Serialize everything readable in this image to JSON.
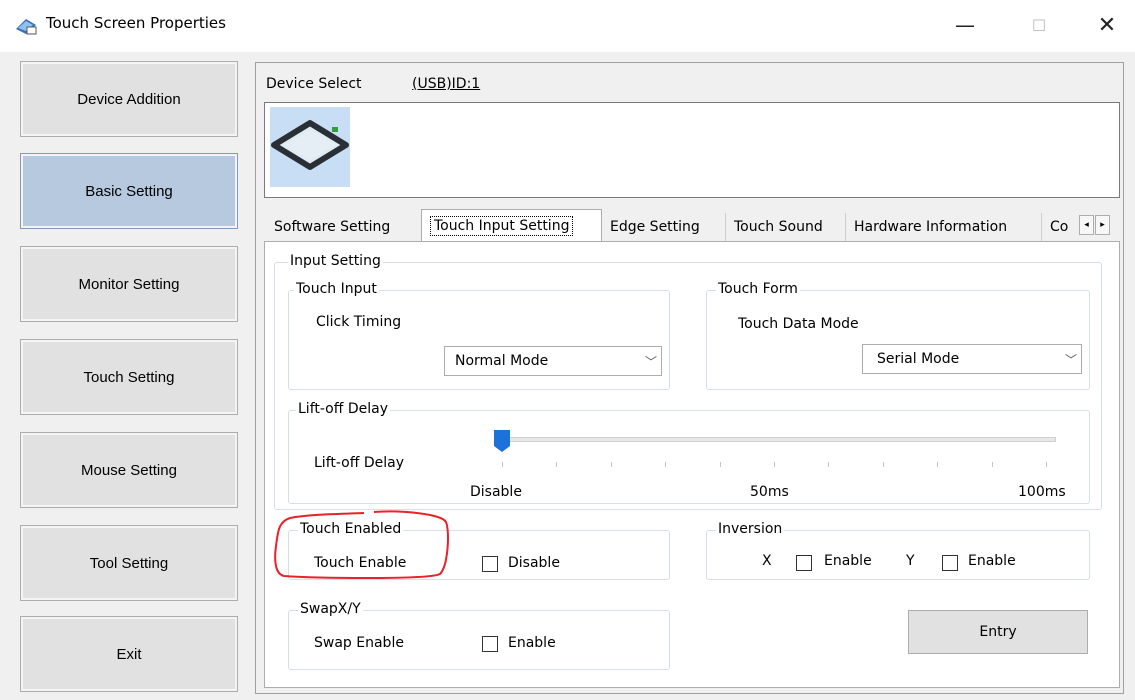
{
  "window": {
    "title": "Touch Screen Properties",
    "min_glyph": "—",
    "max_glyph": "☐",
    "close_glyph": "✕"
  },
  "sidebar": {
    "items": [
      {
        "label": "Device Addition",
        "active": false
      },
      {
        "label": "Basic Setting",
        "active": true
      },
      {
        "label": "Monitor Setting",
        "active": false
      },
      {
        "label": "Touch Setting",
        "active": false
      },
      {
        "label": "Mouse Setting",
        "active": false
      },
      {
        "label": "Tool Setting",
        "active": false
      },
      {
        "label": "Exit",
        "active": false
      }
    ]
  },
  "device_select": {
    "label": "Device Select",
    "value": "(USB)ID:1",
    "icon": "touchscreen-device-icon"
  },
  "tabs": [
    {
      "label": "Software Setting"
    },
    {
      "label": "Touch Input Setting",
      "active": true
    },
    {
      "label": "Edge Setting"
    },
    {
      "label": "Touch Sound"
    },
    {
      "label": "Hardware Information"
    },
    {
      "label": "Co"
    }
  ],
  "tab_scroll": {
    "left": "◂",
    "right": "▸"
  },
  "input_setting": {
    "legend": "Input Setting",
    "touch_input": {
      "legend": "Touch Input",
      "label": "Click Timing",
      "value": "Normal Mode"
    },
    "touch_form": {
      "legend": "Touch Form",
      "label": "Touch Data Mode",
      "value": "Serial Mode"
    },
    "lift_off": {
      "legend": "Lift-off Delay",
      "label": "Lift-off Delay",
      "slider_level": 0,
      "ticks": [
        "Disable",
        "50ms",
        "100ms"
      ]
    }
  },
  "touch_enabled": {
    "legend": "Touch Enabled",
    "label": "Touch Enable",
    "checkbox_label": "Disable",
    "checked": false
  },
  "inversion": {
    "legend": "Inversion",
    "x_label": "X",
    "x_checkbox": "Enable",
    "y_label": "Y",
    "y_checkbox": "Enable"
  },
  "swap": {
    "legend": "SwapX/Y",
    "label": "Swap Enable",
    "checkbox_label": "Enable",
    "checked": false
  },
  "entry_button": "Entry",
  "colors": {
    "active_sidebar": "#b7c9df",
    "annotation": "#e8212a",
    "slider_thumb": "#1c72d8"
  }
}
